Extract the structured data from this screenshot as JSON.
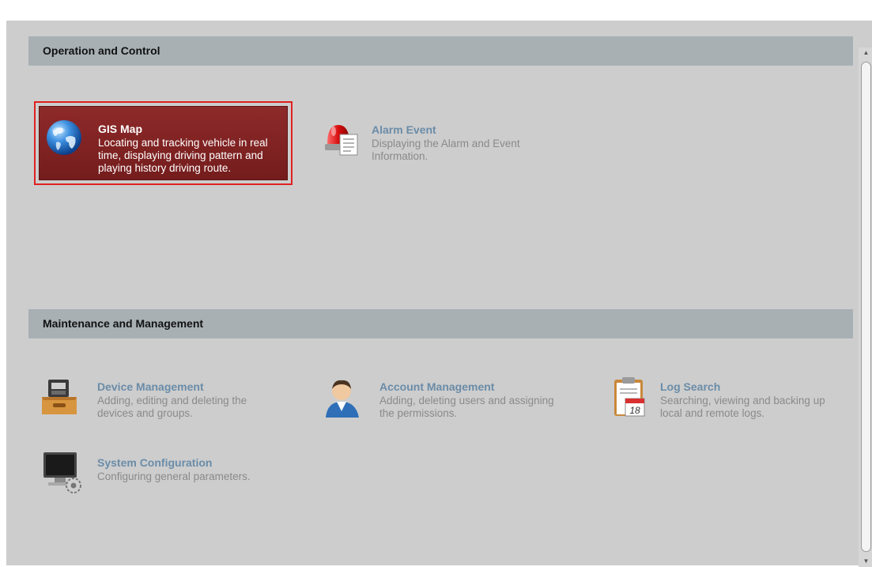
{
  "sections": [
    {
      "title": "Operation and Control",
      "tiles": [
        {
          "title": "GIS Map",
          "desc": "Locating and tracking vehicle in real time, displaying driving pattern and playing history driving route.",
          "icon": "globe-icon",
          "selected": true
        },
        {
          "title": "Alarm Event",
          "desc": "Displaying the Alarm and Event Information.",
          "icon": "alarm-siren-icon"
        }
      ]
    },
    {
      "title": "Maintenance and Management",
      "tiles": [
        {
          "title": "Device Management",
          "desc": "Adding, editing and deleting the devices and groups.",
          "icon": "device-box-icon"
        },
        {
          "title": "Account Management",
          "desc": "Adding, deleting users and assigning the permissions.",
          "icon": "user-account-icon"
        },
        {
          "title": "Log Search",
          "desc": "Searching, viewing and backing up local and remote logs.",
          "icon": "calendar-log-icon",
          "icon_text": "18"
        },
        {
          "title": "System Configuration",
          "desc": "Configuring general parameters.",
          "icon": "monitor-gear-icon"
        }
      ]
    }
  ],
  "scrollbar": {
    "up_arrow": "▲",
    "down_arrow": "▼"
  },
  "colors": {
    "selected_tile": "#7e2222",
    "selected_border": "#e02020",
    "section_header": "#a8b0b4",
    "tile_title": "#6a8ca8"
  }
}
